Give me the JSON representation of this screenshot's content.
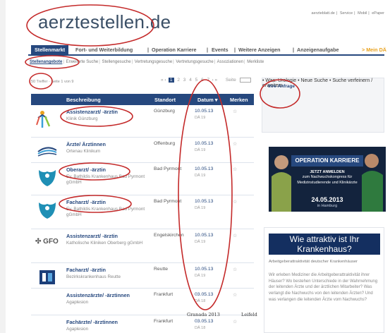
{
  "top_links": [
    "aerzteblatt.de",
    "Service",
    "Mobil",
    "ePaper"
  ],
  "logo": "aerztestellen.de",
  "main_nav": [
    "Stellenmarkt",
    "Fort- und Weiterbildung",
    "Operation Karriere",
    "Events",
    "Weitere Anzeigen",
    "Anzeigenaufgabe"
  ],
  "main_nav_mein": "> Mein DÄ",
  "sub_nav": [
    "Stellenangebote",
    "Erweiterte Suche",
    "Stellengesuche",
    "Vertretungsgesuche",
    "Vertretungsgesuche",
    "Assoziationen",
    "Merkliste"
  ],
  "results_text": "50 Treffer · Seite 1 von 9",
  "pager": {
    "prev": "« ‹",
    "pages": [
      "1",
      "2",
      "3",
      "4",
      "5",
      "6",
      "7"
    ],
    "current": "1",
    "next": "› »",
    "goto_label": "Seite"
  },
  "table_header": {
    "beschreibung": "Beschreibung",
    "standort": "Standort",
    "datum": "Datum ▾",
    "merken": "Merken"
  },
  "listings": [
    {
      "title": "Assistenzarzt/ -ärztin",
      "employer": "Klinik Günzburg",
      "location": "Günzburg",
      "date": "10.05.13",
      "tag": "DÄ 19",
      "logo_icon": "klinik-guenzburg-logo-icon"
    },
    {
      "title": "Ärzte/ Ärztinnen",
      "employer": "Ortenau Klinikum",
      "location": "Offenburg",
      "date": "10.05.13",
      "tag": "DÄ 19",
      "logo_icon": "ortenau-klinikum-logo-icon"
    },
    {
      "title": "Oberarzt/ -ärztin",
      "employer": "Ev. Bathildis Krankenhaus Bad Pyrmont gGmbH",
      "location": "Bad Pyrmont",
      "date": "10.05.13",
      "tag": "DÄ 19",
      "logo_icon": "bathildis-logo-icon"
    },
    {
      "title": "Facharzt/ -ärztin",
      "employer": "Ev. Bathildis Krankenhaus Bad Pyrmont gGmbH",
      "location": "Bad Pyrmont",
      "date": "10.05.13",
      "tag": "DÄ 19",
      "logo_icon": "bathildis-logo-icon"
    },
    {
      "title": "Assistenzarzt/ -ärztin",
      "employer": "Katholische Kliniken Oberberg gGmbH",
      "location": "Engelskirchen",
      "date": "10.05.13",
      "tag": "DÄ 19",
      "logo_icon": "gfo-logo-icon",
      "logo_text": "GFO"
    },
    {
      "title": "Facharzt/ -ärztin",
      "employer": "Bezirkskrankenhaus Reutte",
      "location": "Reutte",
      "date": "10.05.13",
      "tag": "DÄ 19",
      "logo_icon": "bkh-reutte-logo-icon"
    },
    {
      "title": "Assistenzärzte/ -ärztinnen",
      "employer": "Agaplesion",
      "location": "Frankfurt",
      "date": "03.05.13",
      "tag": "DÄ 18",
      "logo_icon": ""
    },
    {
      "title": "Fachärzte/ -ärztinnen",
      "employer": "Agaplesion",
      "location": "Frankfurt",
      "date": "03.05.13",
      "tag": "DÄ 18",
      "logo_icon": ""
    }
  ],
  "sidebar": {
    "title": "Ihre Anfrage",
    "links": [
      "Was: Urologie",
      "Neue Suche",
      "Suche verfeinern / erweitern"
    ]
  },
  "promo": {
    "heading": "OPERATION KARRIERE",
    "subheading": "JETZT ANMELDEN",
    "text": "zum Nachwuchskongress für Medizinstudierende und Klinikärzte",
    "date": "24.05.2013",
    "city": "in Hamburg"
  },
  "ad": {
    "title": "Wie attraktiv ist Ihr Krankenhaus?",
    "headline": "Arbeitgeberattraktivität deutscher Krankenhäuser",
    "body": "Wir erleben Mediziner die Arbeitgeberattraktivität ihrer Häuser? Wo bestehen Unterschiede in der Wahrnehmung der leitenden Ärzte und der ärztlichen Mitarbeiter? Was verlangt die Nachwuchs von den leitenden Ärzten? Und was verlangen die leitenden Ärzte vom Nachwuchs?"
  },
  "watermarks": [
    "Granada 2013",
    "Leifeld"
  ],
  "colors": {
    "brand": "#26487e",
    "accent": "#e8a21e",
    "annotation": "#c42a2a"
  }
}
